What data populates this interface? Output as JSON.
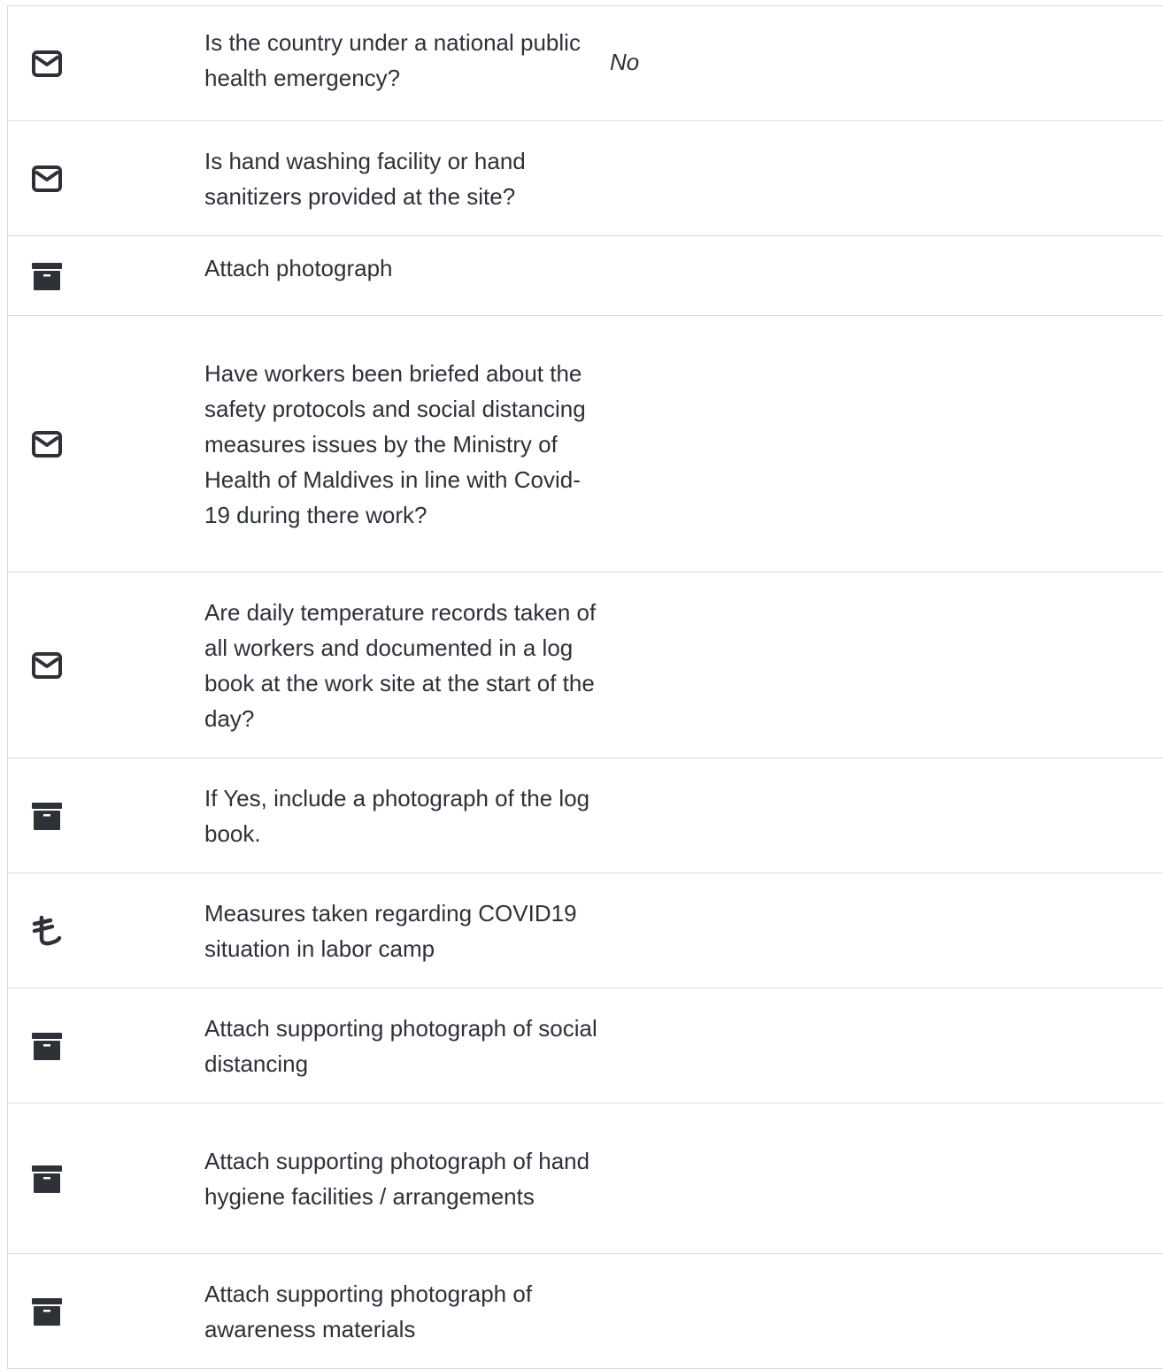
{
  "icon_color": "#2e3138",
  "rows": [
    {
      "icon": "envelope-icon",
      "label": "Is the country under a national public health emergency?",
      "value": "No"
    },
    {
      "icon": "envelope-icon",
      "label": "Is hand washing facility or hand sanitizers provided at the site?",
      "value": ""
    },
    {
      "icon": "archive-icon",
      "label": "Attach photograph",
      "value": ""
    },
    {
      "icon": "envelope-icon",
      "label": "Have workers been briefed about the safety protocols and social distancing measures issues by the Ministry of Health of Maldives in line with Covid-19 during there work?",
      "value": ""
    },
    {
      "icon": "envelope-icon",
      "label": "Are daily temperature records taken of all workers and documented in a log book at the work site at the start of the day?",
      "value": ""
    },
    {
      "icon": "archive-icon",
      "label": "If Yes, include a photograph of the log book.",
      "value": ""
    },
    {
      "icon": "tenge-icon",
      "label": "Measures taken regarding COVID19 situation in labor camp",
      "value": ""
    },
    {
      "icon": "archive-icon",
      "label": "Attach supporting photograph of social distancing",
      "value": ""
    },
    {
      "icon": "archive-icon",
      "label": "Attach supporting photograph of hand hygiene facilities / arrangements",
      "value": ""
    },
    {
      "icon": "archive-icon",
      "label": "Attach supporting photograph of awareness materials",
      "value": ""
    }
  ]
}
